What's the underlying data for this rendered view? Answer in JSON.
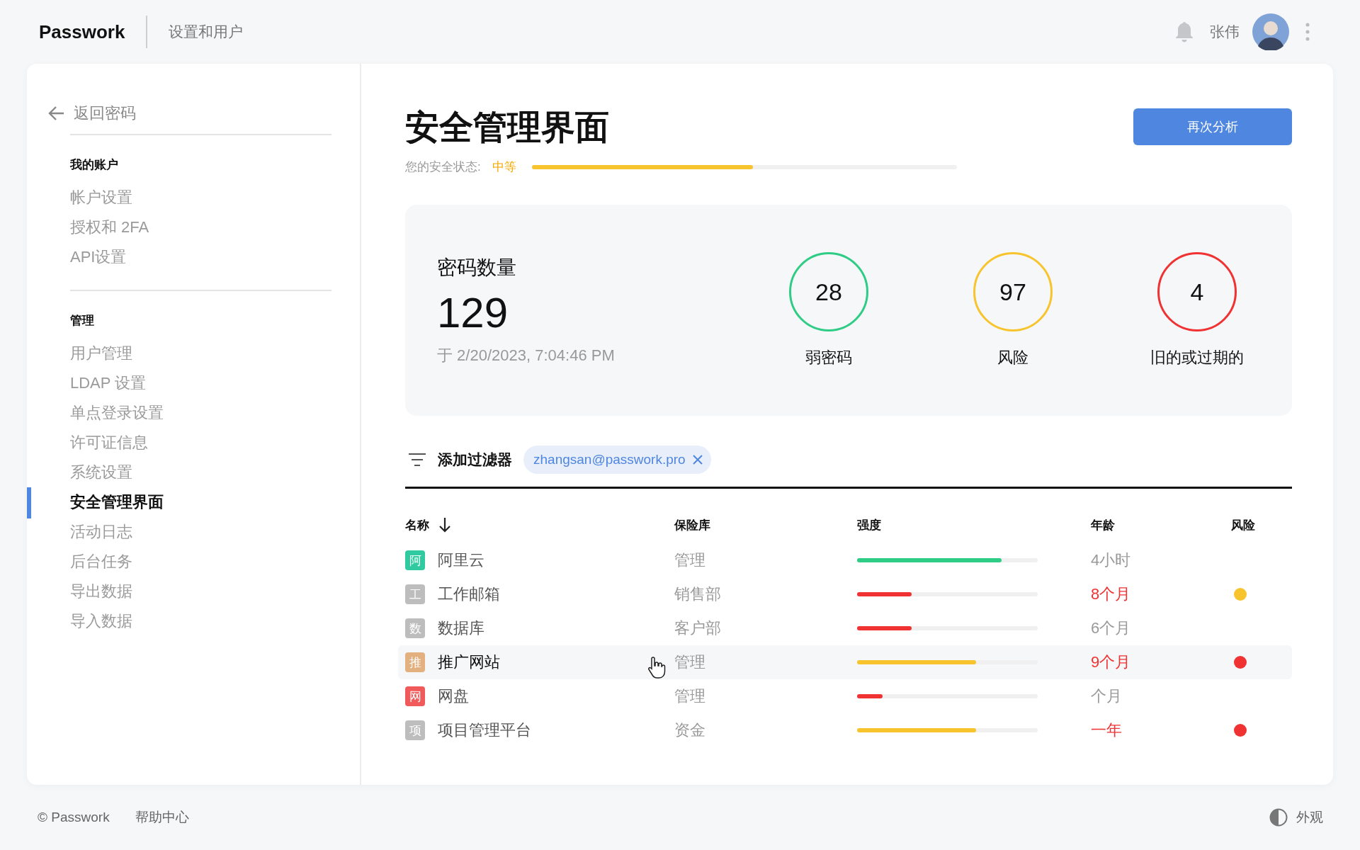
{
  "header": {
    "logo": "Passwork",
    "section": "设置和用户",
    "user_name": "张伟"
  },
  "sidebar": {
    "back": "返回密码",
    "groups": [
      {
        "title": "我的账户",
        "items": [
          {
            "label": "帐户设置",
            "selected": false
          },
          {
            "label": "授权和 2FA",
            "selected": false
          },
          {
            "label": "API设置",
            "selected": false
          }
        ]
      },
      {
        "title": "管理",
        "items": [
          {
            "label": "用户管理",
            "selected": false
          },
          {
            "label": "LDAP 设置",
            "selected": false
          },
          {
            "label": "单点登录设置",
            "selected": false
          },
          {
            "label": "许可证信息",
            "selected": false
          },
          {
            "label": "系统设置",
            "selected": false
          },
          {
            "label": "安全管理界面",
            "selected": true
          },
          {
            "label": "活动日志",
            "selected": false
          },
          {
            "label": "后台任务",
            "selected": false
          },
          {
            "label": "导出数据",
            "selected": false
          },
          {
            "label": "导入数据",
            "selected": false
          }
        ]
      }
    ]
  },
  "main": {
    "title": "安全管理界面",
    "analyze_button": "再次分析",
    "status": {
      "label": "您的安全状态:",
      "value": "中等",
      "level": 0.52
    },
    "summary": {
      "label": "密码数量",
      "count": "129",
      "date": "于 2/20/2023, 7:04:46 PM",
      "stats": [
        {
          "value": "28",
          "label": "弱密码",
          "color": "#2ecc85"
        },
        {
          "value": "97",
          "label": "风险",
          "color": "#f8c42e"
        },
        {
          "value": "4",
          "label": "旧的或过期的",
          "color": "#f03232"
        }
      ]
    },
    "filter": {
      "label": "添加过滤器",
      "chip": "zhangsan@passwork.pro"
    },
    "table": {
      "columns": [
        "名称",
        "保险库",
        "强度",
        "年龄",
        "风险"
      ],
      "rows": [
        {
          "badge": "阿",
          "color": "#2fcaa0",
          "name": "阿里云",
          "vault": "管理",
          "strength": {
            "level": 0.8,
            "kind": "strong"
          },
          "age": "4小时",
          "overdue": false,
          "highlighted": false
        },
        {
          "badge": "工",
          "color": "#bdbdbd",
          "name": "工作邮箱",
          "vault": "销售部",
          "strength": {
            "level": 0.3,
            "kind": "weak"
          },
          "age": "8个月",
          "overdue": true,
          "highlighted": false,
          "risk": {
            "color": "#f8c42e"
          }
        },
        {
          "badge": "数",
          "color": "#bdbdbd",
          "name": "数据库",
          "vault": "客户部",
          "strength": {
            "level": 0.3,
            "kind": "weak"
          },
          "age": "6个月",
          "overdue": false,
          "highlighted": false
        },
        {
          "badge": "推",
          "color": "#e3b080",
          "name": "推广网站",
          "vault": "管理",
          "strength": {
            "level": 0.66,
            "kind": "medium"
          },
          "age": "9个月",
          "overdue": true,
          "highlighted": true,
          "risk": {
            "color": "#f03232"
          }
        },
        {
          "badge": "网",
          "color": "#f05a5a",
          "name": "网盘",
          "vault": "管理",
          "strength": {
            "level": 0.14,
            "kind": "weak"
          },
          "age": "个月",
          "overdue": false,
          "highlighted": false
        },
        {
          "badge": "项",
          "color": "#bdbdbd",
          "name": "项目管理平台",
          "vault": "资金",
          "strength": {
            "level": 0.66,
            "kind": "medium"
          },
          "age": "一年",
          "overdue": true,
          "highlighted": false,
          "risk": {
            "color": "#f03232"
          }
        }
      ]
    }
  },
  "footer": {
    "copyright": "© Passwork",
    "help": "帮助中心",
    "appearance": "外观"
  }
}
